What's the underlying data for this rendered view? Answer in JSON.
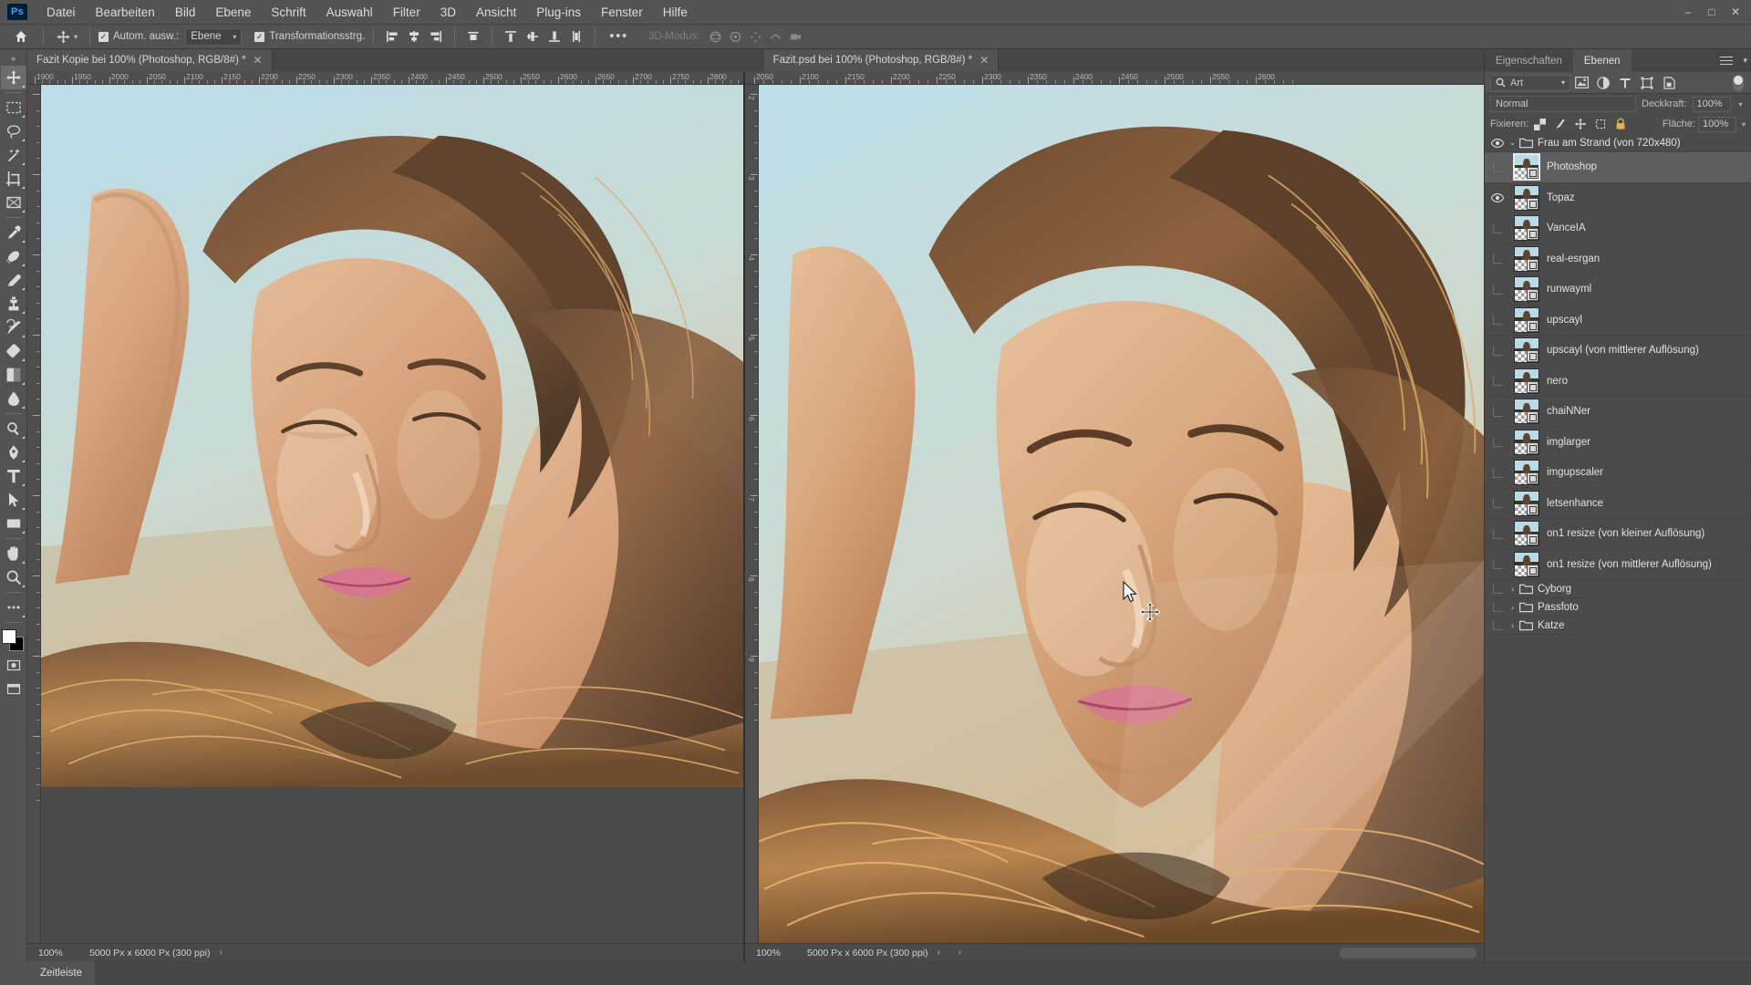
{
  "app": {
    "logo": "Ps"
  },
  "menubar": {
    "items": [
      {
        "label": "Datei"
      },
      {
        "label": "Bearbeiten"
      },
      {
        "label": "Bild"
      },
      {
        "label": "Ebene"
      },
      {
        "label": "Schrift"
      },
      {
        "label": "Auswahl"
      },
      {
        "label": "Filter"
      },
      {
        "label": "3D"
      },
      {
        "label": "Ansicht"
      },
      {
        "label": "Plug-ins"
      },
      {
        "label": "Fenster"
      },
      {
        "label": "Hilfe"
      }
    ],
    "window_controls": [
      {
        "name": "minimize",
        "glyph": "–"
      },
      {
        "name": "maximize",
        "glyph": "□"
      },
      {
        "name": "close",
        "glyph": "✕"
      }
    ]
  },
  "options_bar": {
    "home_icon": "home-icon",
    "tool_icon": "move-tool-icon",
    "auto_select_label": "Autom. ausw.:",
    "auto_select_checked": true,
    "auto_select_value": "Ebene",
    "transform_controls_label": "Transformationsstrg.",
    "transform_controls_checked": true,
    "align_buttons": [
      "align-left-edges",
      "align-horizontal-centers",
      "align-right-edges",
      "align-top-edges",
      "align-vertical-centers",
      "align-bottom-edges",
      "distribute-vertical"
    ],
    "more_label": "•••",
    "threed_mode_label": "3D-Modus:",
    "threed_disabled": true
  },
  "toolbar": {
    "tools": [
      {
        "name": "move-tool",
        "active": true
      },
      {
        "name": "rectangular-marquee-tool",
        "active": false
      },
      {
        "name": "lasso-tool",
        "active": false
      },
      {
        "name": "magic-wand-tool",
        "active": false
      },
      {
        "name": "crop-tool",
        "active": false
      },
      {
        "name": "frame-tool",
        "active": false
      },
      {
        "name": "eyedropper-tool",
        "active": false
      },
      {
        "name": "healing-brush-tool",
        "active": false
      },
      {
        "name": "brush-tool",
        "active": false
      },
      {
        "name": "clone-stamp-tool",
        "active": false
      },
      {
        "name": "history-brush-tool",
        "active": false
      },
      {
        "name": "eraser-tool",
        "active": false
      },
      {
        "name": "gradient-tool",
        "active": false
      },
      {
        "name": "blur-tool",
        "active": false
      },
      {
        "name": "dodge-tool",
        "active": false
      },
      {
        "name": "pen-tool",
        "active": false
      },
      {
        "name": "type-tool",
        "active": false
      },
      {
        "name": "path-selection-tool",
        "active": false
      },
      {
        "name": "rectangle-tool",
        "active": false
      },
      {
        "name": "hand-tool",
        "active": false
      },
      {
        "name": "zoom-tool",
        "active": false
      },
      {
        "name": "more-tools",
        "active": false
      }
    ],
    "foreground_color": "#ffffff",
    "background_color": "#000000"
  },
  "documents": {
    "tabs": [
      {
        "title": "Fazit Kopie bei 100% (Photoshop, RGB/8#) *",
        "active": true,
        "close_glyph": "✕"
      },
      {
        "title": "Fazit.psd bei 100% (Photoshop, RGB/8#) *",
        "active": true,
        "close_glyph": "✕"
      }
    ]
  },
  "left_pane": {
    "ruler_labels": [
      "1900",
      "1950",
      "2000",
      "2050",
      "2100",
      "2150",
      "2200",
      "2250",
      "2300",
      "2350",
      "2400",
      "2450",
      "2500",
      "2550",
      "2600",
      "2650",
      "2700",
      "2750",
      "2800"
    ],
    "status": {
      "zoom": "100%",
      "size": "5000 Px x 6000 Px (300 ppi)",
      "arrow": "›"
    }
  },
  "right_pane": {
    "ruler_labels": [
      "2050",
      "2100",
      "2150",
      "2200",
      "2250",
      "2300",
      "2350",
      "2400",
      "2450",
      "2500",
      "2550",
      "2600"
    ],
    "vruler_labels": [
      "2",
      "3",
      "4",
      "5",
      "6",
      "7",
      "8",
      "9"
    ],
    "status": {
      "zoom": "100%",
      "size": "5000 Px x 6000 Px (300 ppi)",
      "arrow": "›",
      "arrow2": "‹"
    }
  },
  "panels": {
    "tabs": [
      {
        "label": "Eigenschaften",
        "active": false
      },
      {
        "label": "Ebenen",
        "active": true
      }
    ],
    "menu_icon": "hamburger-icon",
    "collapse_icon": "chevron-down-icon",
    "filter": {
      "search_icon": "search-icon",
      "kind_label": "Art",
      "chevron": "⌄",
      "icons": [
        "image-filter-icon",
        "adjustment-filter-icon",
        "type-filter-icon",
        "shape-filter-icon",
        "smartobject-filter-icon"
      ],
      "toggle_name": "filter-enable-toggle"
    },
    "blend": {
      "mode": "Normal",
      "opacity_label": "Deckkraft:",
      "opacity_value": "100%",
      "fill_label": "Fläche:",
      "fill_value": "100%",
      "lock_label": "Fixieren:",
      "lock_icons": [
        "lock-transparency-icon",
        "lock-image-icon",
        "lock-position-icon",
        "lock-artboard-icon",
        "lock-all-icon"
      ]
    },
    "layers": [
      {
        "name": "Frau am Strand (von 720x480)",
        "type": "group",
        "expanded": true,
        "visible": true,
        "selected": false,
        "indent": 0
      },
      {
        "name": "Photoshop",
        "type": "layer",
        "visible": false,
        "selected": true,
        "indent": 1
      },
      {
        "name": "Topaz",
        "type": "layer",
        "visible": true,
        "selected": false,
        "indent": 1
      },
      {
        "name": "VanceIA",
        "type": "layer",
        "visible": false,
        "selected": false,
        "indent": 1
      },
      {
        "name": "real-esrgan",
        "type": "layer",
        "visible": false,
        "selected": false,
        "indent": 1
      },
      {
        "name": "runwayml",
        "type": "layer",
        "visible": false,
        "selected": false,
        "indent": 1
      },
      {
        "name": "upscayl",
        "type": "layer",
        "visible": false,
        "selected": false,
        "indent": 1
      },
      {
        "name": "upscayl (von mittlerer Auflösung)",
        "type": "layer",
        "visible": false,
        "selected": false,
        "indent": 1
      },
      {
        "name": "nero",
        "type": "layer",
        "visible": false,
        "selected": false,
        "indent": 1
      },
      {
        "name": "chaiNNer",
        "type": "layer",
        "visible": false,
        "selected": false,
        "indent": 1
      },
      {
        "name": "imglarger",
        "type": "layer",
        "visible": false,
        "selected": false,
        "indent": 1
      },
      {
        "name": "imgupscaler",
        "type": "layer",
        "visible": false,
        "selected": false,
        "indent": 1
      },
      {
        "name": "letsenhance",
        "type": "layer",
        "visible": false,
        "selected": false,
        "indent": 1
      },
      {
        "name": "on1 resize (von kleiner Auflösung)",
        "type": "layer",
        "visible": false,
        "selected": false,
        "indent": 1
      },
      {
        "name": "on1 resize (von mittlerer Auflösung)",
        "type": "layer",
        "visible": false,
        "selected": false,
        "indent": 1
      },
      {
        "name": "Cyborg",
        "type": "group",
        "expanded": false,
        "visible": false,
        "selected": false,
        "indent": 0
      },
      {
        "name": "Passfoto",
        "type": "group",
        "expanded": false,
        "visible": false,
        "selected": false,
        "indent": 0
      },
      {
        "name": "Katze",
        "type": "group",
        "expanded": false,
        "visible": false,
        "selected": false,
        "indent": 0
      }
    ]
  },
  "bottom": {
    "timeline_label": "Zeitleiste"
  },
  "colors": {
    "panel_bg": "#4b4b4b",
    "chrome_bg": "#535353",
    "canvas_bg": "#3f3f3f",
    "selected_row": "#5e5e5e",
    "text": "#e2e2e2",
    "accent": "#31a8ff"
  }
}
